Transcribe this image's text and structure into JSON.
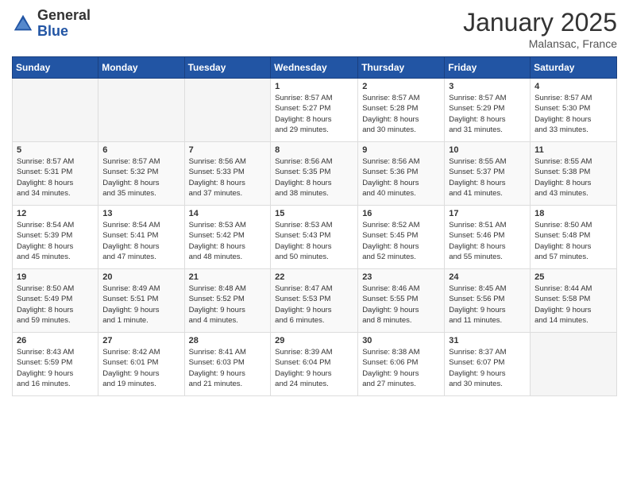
{
  "header": {
    "logo_general": "General",
    "logo_blue": "Blue",
    "month_title": "January 2025",
    "location": "Malansac, France"
  },
  "days_of_week": [
    "Sunday",
    "Monday",
    "Tuesday",
    "Wednesday",
    "Thursday",
    "Friday",
    "Saturday"
  ],
  "weeks": [
    [
      {
        "day": "",
        "info": ""
      },
      {
        "day": "",
        "info": ""
      },
      {
        "day": "",
        "info": ""
      },
      {
        "day": "1",
        "info": "Sunrise: 8:57 AM\nSunset: 5:27 PM\nDaylight: 8 hours\nand 29 minutes."
      },
      {
        "day": "2",
        "info": "Sunrise: 8:57 AM\nSunset: 5:28 PM\nDaylight: 8 hours\nand 30 minutes."
      },
      {
        "day": "3",
        "info": "Sunrise: 8:57 AM\nSunset: 5:29 PM\nDaylight: 8 hours\nand 31 minutes."
      },
      {
        "day": "4",
        "info": "Sunrise: 8:57 AM\nSunset: 5:30 PM\nDaylight: 8 hours\nand 33 minutes."
      }
    ],
    [
      {
        "day": "5",
        "info": "Sunrise: 8:57 AM\nSunset: 5:31 PM\nDaylight: 8 hours\nand 34 minutes."
      },
      {
        "day": "6",
        "info": "Sunrise: 8:57 AM\nSunset: 5:32 PM\nDaylight: 8 hours\nand 35 minutes."
      },
      {
        "day": "7",
        "info": "Sunrise: 8:56 AM\nSunset: 5:33 PM\nDaylight: 8 hours\nand 37 minutes."
      },
      {
        "day": "8",
        "info": "Sunrise: 8:56 AM\nSunset: 5:35 PM\nDaylight: 8 hours\nand 38 minutes."
      },
      {
        "day": "9",
        "info": "Sunrise: 8:56 AM\nSunset: 5:36 PM\nDaylight: 8 hours\nand 40 minutes."
      },
      {
        "day": "10",
        "info": "Sunrise: 8:55 AM\nSunset: 5:37 PM\nDaylight: 8 hours\nand 41 minutes."
      },
      {
        "day": "11",
        "info": "Sunrise: 8:55 AM\nSunset: 5:38 PM\nDaylight: 8 hours\nand 43 minutes."
      }
    ],
    [
      {
        "day": "12",
        "info": "Sunrise: 8:54 AM\nSunset: 5:39 PM\nDaylight: 8 hours\nand 45 minutes."
      },
      {
        "day": "13",
        "info": "Sunrise: 8:54 AM\nSunset: 5:41 PM\nDaylight: 8 hours\nand 47 minutes."
      },
      {
        "day": "14",
        "info": "Sunrise: 8:53 AM\nSunset: 5:42 PM\nDaylight: 8 hours\nand 48 minutes."
      },
      {
        "day": "15",
        "info": "Sunrise: 8:53 AM\nSunset: 5:43 PM\nDaylight: 8 hours\nand 50 minutes."
      },
      {
        "day": "16",
        "info": "Sunrise: 8:52 AM\nSunset: 5:45 PM\nDaylight: 8 hours\nand 52 minutes."
      },
      {
        "day": "17",
        "info": "Sunrise: 8:51 AM\nSunset: 5:46 PM\nDaylight: 8 hours\nand 55 minutes."
      },
      {
        "day": "18",
        "info": "Sunrise: 8:50 AM\nSunset: 5:48 PM\nDaylight: 8 hours\nand 57 minutes."
      }
    ],
    [
      {
        "day": "19",
        "info": "Sunrise: 8:50 AM\nSunset: 5:49 PM\nDaylight: 8 hours\nand 59 minutes."
      },
      {
        "day": "20",
        "info": "Sunrise: 8:49 AM\nSunset: 5:51 PM\nDaylight: 9 hours\nand 1 minute."
      },
      {
        "day": "21",
        "info": "Sunrise: 8:48 AM\nSunset: 5:52 PM\nDaylight: 9 hours\nand 4 minutes."
      },
      {
        "day": "22",
        "info": "Sunrise: 8:47 AM\nSunset: 5:53 PM\nDaylight: 9 hours\nand 6 minutes."
      },
      {
        "day": "23",
        "info": "Sunrise: 8:46 AM\nSunset: 5:55 PM\nDaylight: 9 hours\nand 8 minutes."
      },
      {
        "day": "24",
        "info": "Sunrise: 8:45 AM\nSunset: 5:56 PM\nDaylight: 9 hours\nand 11 minutes."
      },
      {
        "day": "25",
        "info": "Sunrise: 8:44 AM\nSunset: 5:58 PM\nDaylight: 9 hours\nand 14 minutes."
      }
    ],
    [
      {
        "day": "26",
        "info": "Sunrise: 8:43 AM\nSunset: 5:59 PM\nDaylight: 9 hours\nand 16 minutes."
      },
      {
        "day": "27",
        "info": "Sunrise: 8:42 AM\nSunset: 6:01 PM\nDaylight: 9 hours\nand 19 minutes."
      },
      {
        "day": "28",
        "info": "Sunrise: 8:41 AM\nSunset: 6:03 PM\nDaylight: 9 hours\nand 21 minutes."
      },
      {
        "day": "29",
        "info": "Sunrise: 8:39 AM\nSunset: 6:04 PM\nDaylight: 9 hours\nand 24 minutes."
      },
      {
        "day": "30",
        "info": "Sunrise: 8:38 AM\nSunset: 6:06 PM\nDaylight: 9 hours\nand 27 minutes."
      },
      {
        "day": "31",
        "info": "Sunrise: 8:37 AM\nSunset: 6:07 PM\nDaylight: 9 hours\nand 30 minutes."
      },
      {
        "day": "",
        "info": ""
      }
    ]
  ]
}
